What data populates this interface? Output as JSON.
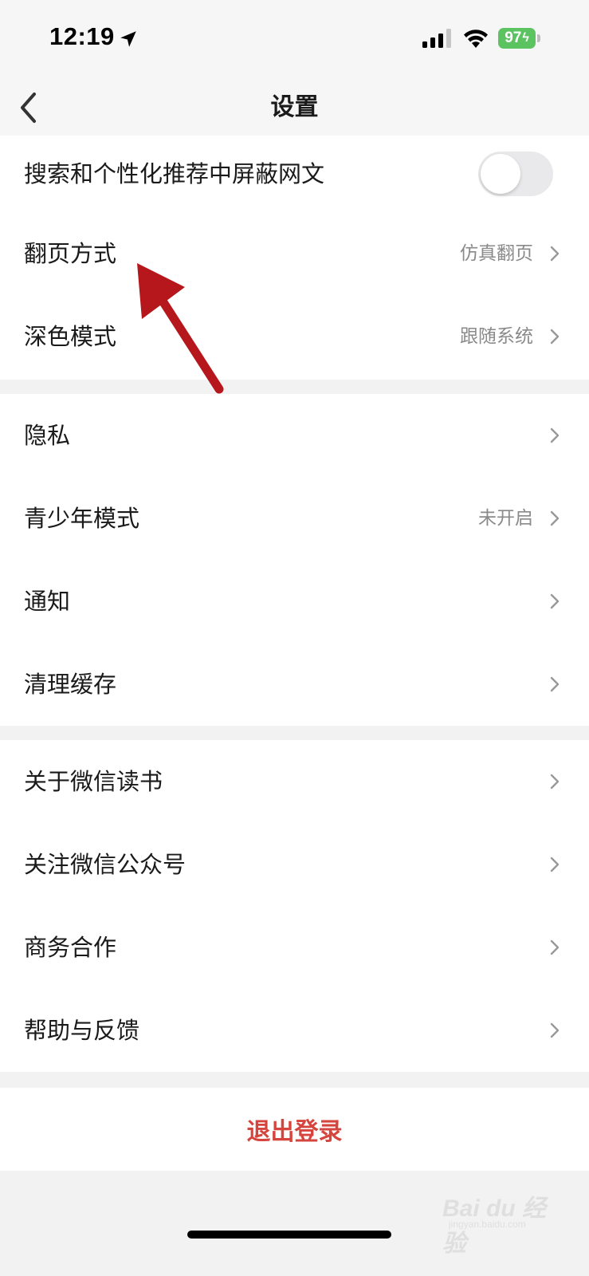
{
  "status_bar": {
    "time": "12:19",
    "battery": "97"
  },
  "nav": {
    "title": "设置"
  },
  "section1": {
    "items": [
      {
        "label": "搜索和个性化推荐中屏蔽网文",
        "toggle_on": false
      },
      {
        "label": "翻页方式",
        "value": "仿真翻页"
      },
      {
        "label": "深色模式",
        "value": "跟随系统"
      }
    ]
  },
  "section2": {
    "items": [
      {
        "label": "隐私",
        "value": ""
      },
      {
        "label": "青少年模式",
        "value": "未开启"
      },
      {
        "label": "通知",
        "value": ""
      },
      {
        "label": "清理缓存",
        "value": ""
      }
    ]
  },
  "section3": {
    "items": [
      {
        "label": "关于微信读书"
      },
      {
        "label": "关注微信公众号"
      },
      {
        "label": "商务合作"
      },
      {
        "label": "帮助与反馈"
      }
    ]
  },
  "logout": {
    "label": "退出登录"
  },
  "watermark": {
    "text": "Bai du 经验",
    "sub": "jingyan.baidu.com"
  },
  "colors": {
    "accent_red": "#d6453d",
    "annotation_arrow": "#b5171c",
    "battery_green": "#5cc361"
  }
}
